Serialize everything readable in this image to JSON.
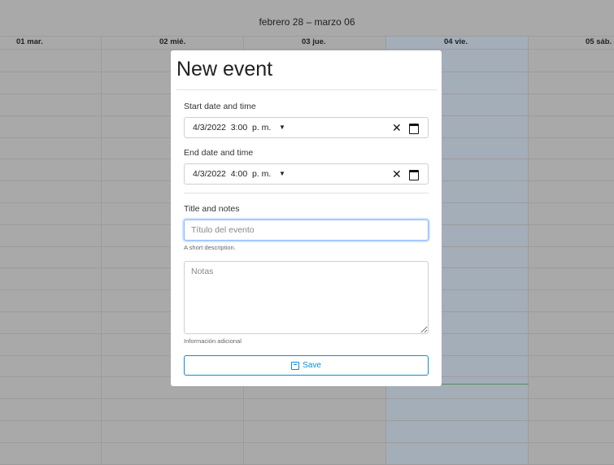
{
  "calendar": {
    "title": "febrero 28 – marzo 06",
    "days": [
      "01 mar.",
      "02 mié.",
      "03 jue.",
      "04 vie.",
      "05 sáb."
    ]
  },
  "modal": {
    "title": "New event",
    "start": {
      "label": "Start date and time",
      "date": "4/3/2022",
      "time": "3:00",
      "ampm": "p. m."
    },
    "end": {
      "label": "End date and time",
      "date": "4/3/2022",
      "time": "4:00",
      "ampm": "p. m."
    },
    "title_section_label": "Title and notes",
    "title_placeholder": "Título del evento",
    "title_help": "A short description.",
    "notes_placeholder": "Notas",
    "notes_help": "Información adicional",
    "save_label": "Save"
  },
  "colors": {
    "accent": "#0d8bd9",
    "overlay": "#a9a9a9",
    "highlight": "#a4aeb9"
  },
  "icons": {
    "clear": "close-icon",
    "calendar": "calendar-icon",
    "save": "save-icon"
  }
}
